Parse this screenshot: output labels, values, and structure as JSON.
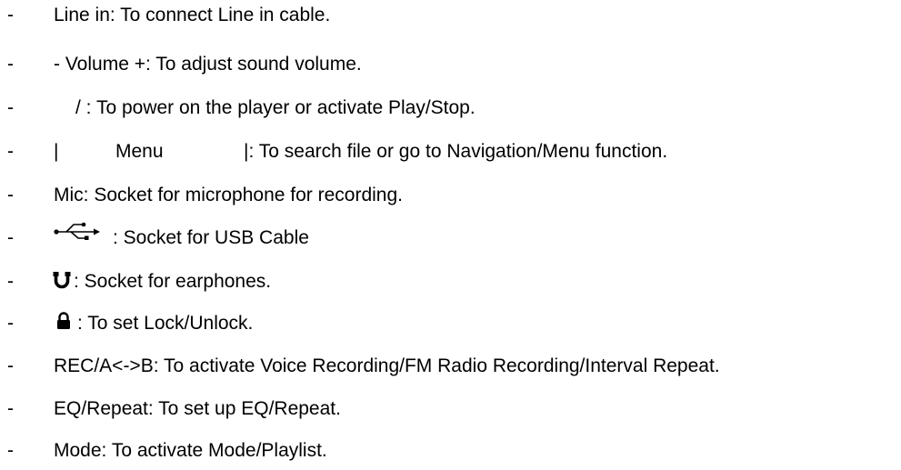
{
  "items": [
    {
      "dash": "-",
      "text": "Line in: To connect Line in cable."
    },
    {
      "dash": "-",
      "text": "- Volume +: To adjust sound volume."
    },
    {
      "dash": "-",
      "text": "/   : To power on the player or activate Play/Stop."
    },
    {
      "dash": "-",
      "text_a": "|",
      "text_b": "Menu",
      "text_c": "|: To search file or go to Navigation/Menu function."
    },
    {
      "dash": "-",
      "text": "Mic: Socket for microphone for recording."
    },
    {
      "dash": "-",
      "icon": "usb-icon",
      "text": ": Socket for USB Cable"
    },
    {
      "dash": "-",
      "icon": "earphone-icon",
      "text": ": Socket for earphones."
    },
    {
      "dash": "-",
      "icon": "lock-icon",
      "text": ": To set Lock/Unlock."
    },
    {
      "dash": "-",
      "text": "REC/A<->B: To activate Voice Recording/FM Radio Recording/Interval Repeat."
    },
    {
      "dash": "-",
      "text": "EQ/Repeat: To set up EQ/Repeat."
    },
    {
      "dash": "-",
      "text": "Mode: To activate Mode/Playlist."
    }
  ]
}
